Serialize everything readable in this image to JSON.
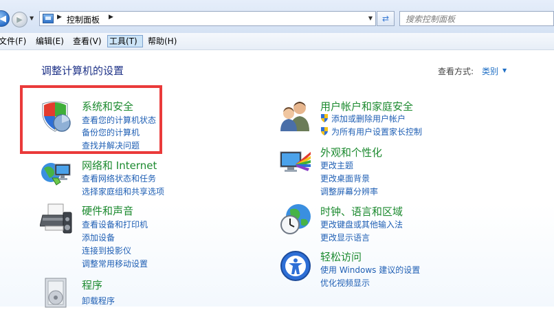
{
  "address_bar": {
    "breadcrumb": "控制面板",
    "search_placeholder": "搜索控制面板"
  },
  "menu": {
    "items": [
      "文件(F)",
      "编辑(E)",
      "查看(V)",
      "工具(T)",
      "帮助(H)"
    ],
    "active": "工具(T)"
  },
  "page": {
    "title": "调整计算机的设置",
    "view_by_label": "查看方式:",
    "view_by_value": "类别"
  },
  "categories": [
    {
      "title": "系统和安全",
      "icon": "shield-icon",
      "highlighted": true,
      "links": [
        "查看您的计算机状态",
        "备份您的计算机",
        "查找并解决问题"
      ]
    },
    {
      "title": "网络和 Internet",
      "icon": "network-icon",
      "links": [
        "查看网络状态和任务",
        "选择家庭组和共享选项"
      ]
    },
    {
      "title": "硬件和声音",
      "icon": "printer-icon",
      "links": [
        "查看设备和打印机",
        "添加设备",
        "连接到投影仪",
        "调整常用移动设置"
      ]
    },
    {
      "title": "程序",
      "icon": "programs-icon",
      "links": [
        "卸载程序"
      ]
    },
    {
      "title": "用户帐户和家庭安全",
      "icon": "users-icon",
      "links": [
        "添加或删除用户帐户",
        "为所有用户设置家长控制"
      ]
    },
    {
      "title": "外观和个性化",
      "icon": "appearance-icon",
      "links": [
        "更改主题",
        "更改桌面背景",
        "调整屏幕分辨率"
      ]
    },
    {
      "title": "时钟、语言和区域",
      "icon": "clock-globe-icon",
      "links": [
        "更改键盘或其他输入法",
        "更改显示语言"
      ]
    },
    {
      "title": "轻松访问",
      "icon": "ease-of-access-icon",
      "links": [
        "使用 Windows 建议的设置",
        "优化视频显示"
      ]
    }
  ],
  "colors": {
    "category_title": "#1c8a2f",
    "link": "#1f5fb4",
    "page_title": "#1e3287",
    "highlight_box": "#ea3a3a"
  }
}
